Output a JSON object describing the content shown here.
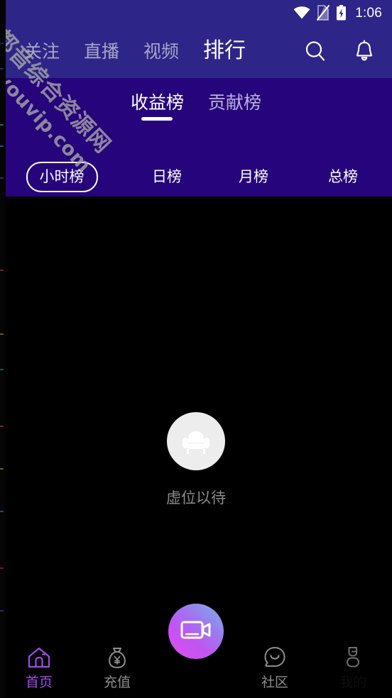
{
  "statusbar": {
    "time": "1:06",
    "icons": [
      "wifi-icon",
      "sim-off-icon",
      "battery-charging-icon"
    ]
  },
  "topnav": {
    "tabs": [
      {
        "label": "关注",
        "active": false
      },
      {
        "label": "直播",
        "active": false
      },
      {
        "label": "视频",
        "active": false
      },
      {
        "label": "排行",
        "active": true
      }
    ],
    "actions": [
      {
        "name": "search-icon"
      },
      {
        "name": "bell-icon"
      }
    ]
  },
  "board": {
    "tabs": [
      {
        "label": "收益榜",
        "active": true
      },
      {
        "label": "贡献榜",
        "active": false
      }
    ],
    "periods": [
      {
        "label": "小时榜",
        "active": true
      },
      {
        "label": "日榜",
        "active": false
      },
      {
        "label": "月榜",
        "active": false
      },
      {
        "label": "总榜",
        "active": false
      }
    ]
  },
  "content": {
    "empty_icon": "armchair-icon",
    "empty_text": "虚位以待"
  },
  "bottomnav": {
    "items": [
      {
        "label": "首页",
        "icon": "home-icon",
        "active": true
      },
      {
        "label": "充值",
        "icon": "money-bag-icon",
        "active": false
      },
      {
        "label": "",
        "icon": "video-camera-icon",
        "active": false
      },
      {
        "label": "社区",
        "icon": "community-smiley-icon",
        "active": false
      },
      {
        "label": "我的",
        "icon": "person-icon",
        "active": false
      }
    ]
  },
  "watermark": {
    "line1": "全都音综合资源网",
    "line2": "ddouyouvip.com"
  },
  "colors": {
    "header": "#2E2589",
    "subheader": "#26047B",
    "content_bg": "#000000",
    "accent": "#A04BE8",
    "active_text": "#FFFFFF",
    "inactive_text": "#A9A7C4"
  }
}
